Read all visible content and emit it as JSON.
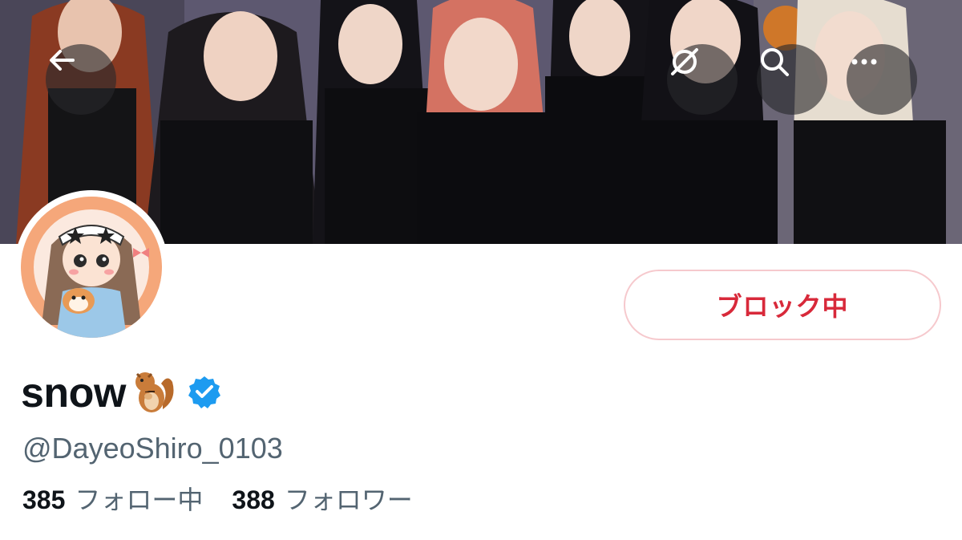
{
  "profile": {
    "display_name": "snow",
    "handle": "@DayeoShiro_0103",
    "verified": true,
    "following_count": "385",
    "following_label": "フォロー中",
    "followers_count": "388",
    "followers_label": "フォロワー"
  },
  "actions": {
    "block_label": "ブロック中"
  },
  "icons": {
    "back": "arrow-left-icon",
    "vpn": "vpn-icon",
    "search": "search-icon",
    "more": "more-dots-icon",
    "name_emoji": "chipmunk-emoji",
    "verified": "verified-badge-icon"
  },
  "colors": {
    "block_text": "#d8293a",
    "block_border": "#f6c9cd",
    "verified_blue": "#1d9bf0",
    "secondary_text": "#536471",
    "primary_text": "#0f1419"
  }
}
